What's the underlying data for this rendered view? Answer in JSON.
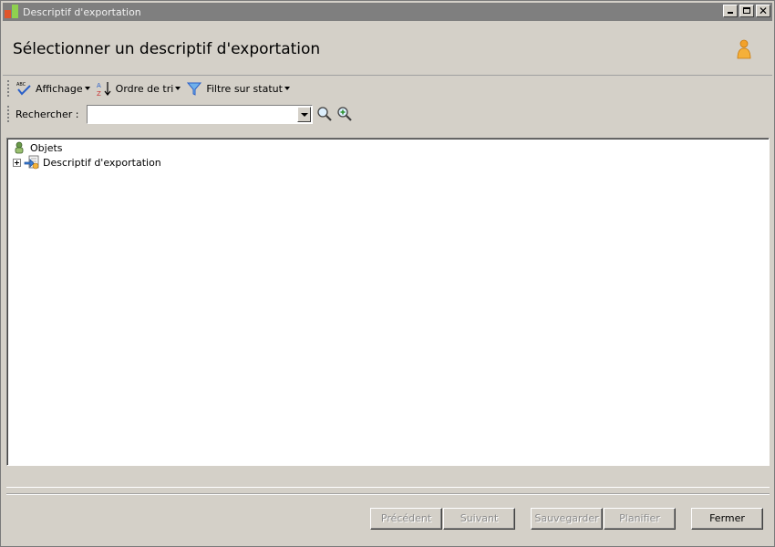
{
  "window": {
    "title": "Descriptif d'exportation"
  },
  "header": {
    "title": "Sélectionner un descriptif d'exportation"
  },
  "toolbar": {
    "view_label": "Affichage",
    "sort_label": "Ordre de tri",
    "filter_label": "Filtre sur statut",
    "search_label": "Rechercher :",
    "search_value": ""
  },
  "tree": {
    "root_label": "Objets",
    "items": [
      {
        "label": "Descriptif d'exportation",
        "expandable": true
      }
    ]
  },
  "buttons": {
    "previous": "Précédent",
    "next": "Suivant",
    "save": "Sauvegarder",
    "schedule": "Planifier",
    "close": "Fermer"
  },
  "colors": {
    "titlebar": "#7f7f7f",
    "window_bg": "#d4d0c8",
    "disabled_text": "#8d8d8d"
  }
}
